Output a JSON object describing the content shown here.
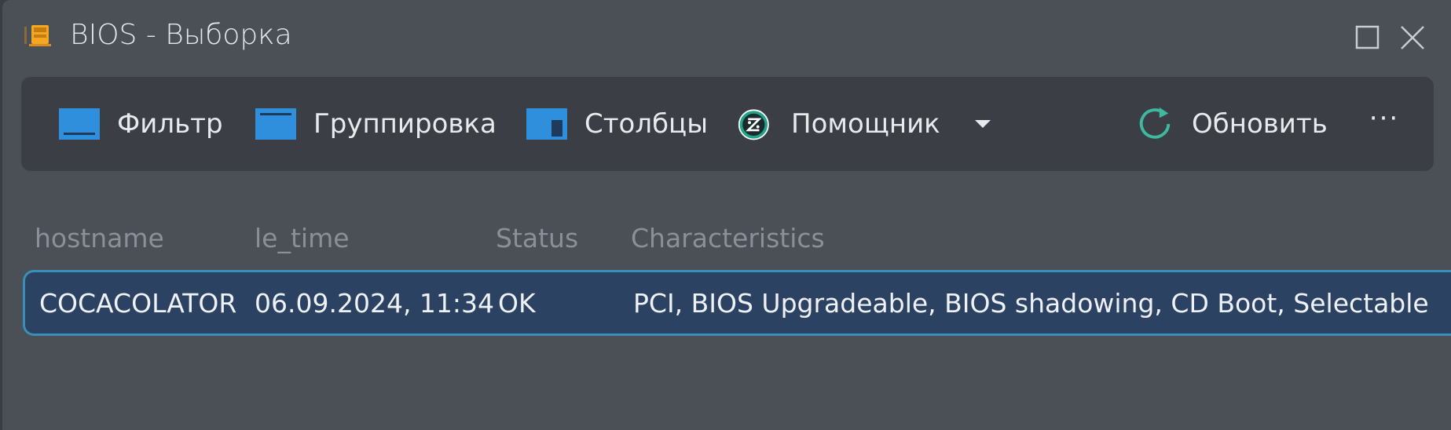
{
  "window": {
    "title": "BIOS - Выборка"
  },
  "toolbar": {
    "filter_label": "Фильтр",
    "group_label": "Группировка",
    "columns_label": "Столбцы",
    "helper_label": "Помощник",
    "refresh_label": "Обновить",
    "more_label": "···"
  },
  "table": {
    "columns": [
      "hostname",
      "le_time",
      "Status",
      "Characteristics"
    ],
    "rows": [
      {
        "hostname": "COCACOLATOR",
        "le_time": "06.09.2024, 11:34",
        "status": "OK",
        "characteristics": "PCI, BIOS Upgradeable, BIOS shadowing, CD Boot, Selectable Boot"
      }
    ]
  },
  "colors": {
    "accent": "#3b8fb7",
    "selected_row": "#2c4263",
    "icon_blue": "#2f8fdc",
    "refresh_teal": "#3fb8a0"
  }
}
